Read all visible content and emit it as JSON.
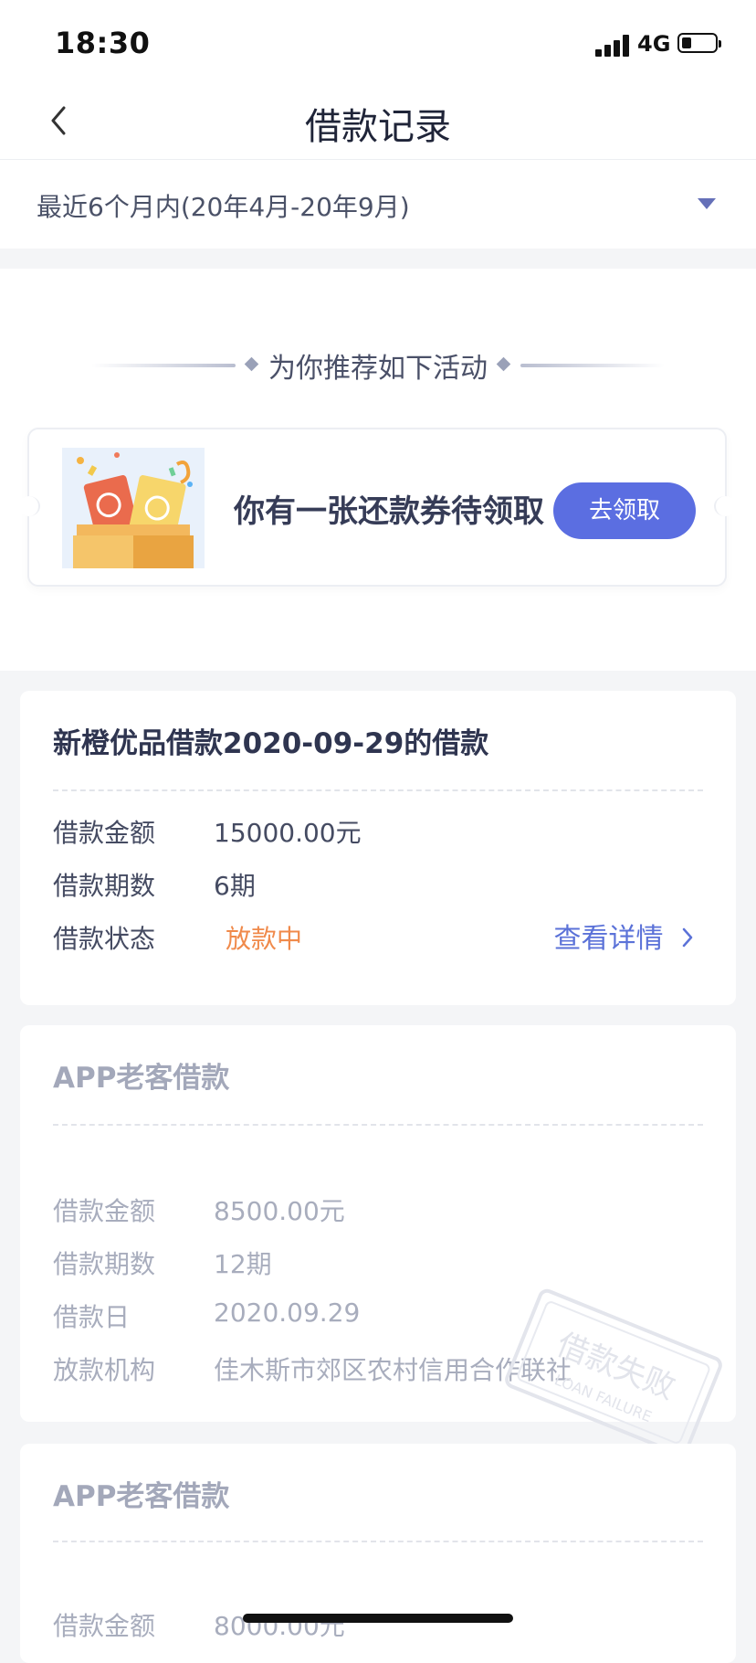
{
  "status_bar": {
    "time": "18:30",
    "network": "4G",
    "battery_level": 0.3
  },
  "nav": {
    "title": "借款记录"
  },
  "filter": {
    "selected_range": "最近6个月内(20年4月-20年9月)"
  },
  "promo": {
    "header": "为你推荐如下活动",
    "coupon_text": "你有一张还款券待领取",
    "claim_button": "去领取"
  },
  "loans": [
    {
      "title": "新橙优品借款2020-09-29的借款",
      "amount_label": "借款金额",
      "amount_value": "15000.00元",
      "periods_label": "借款期数",
      "periods_value": "6期",
      "status_label": "借款状态",
      "status_value": "放款中",
      "detail_link": "查看详情"
    },
    {
      "title": "APP老客借款",
      "amount_label": "借款金额",
      "amount_value": "8500.00元",
      "periods_label": "借款期数",
      "periods_value": "12期",
      "date_label": "借款日",
      "date_value": "2020.09.29",
      "org_label": "放款机构",
      "org_value": "佳木斯市郊区农村信用合作联社",
      "stamp_text": "借款失败",
      "stamp_subtext": "LOAN FAILURE"
    },
    {
      "title": "APP老客借款",
      "amount_label": "借款金额",
      "amount_value": "8000.00元"
    }
  ],
  "colors": {
    "accent": "#5b6ee1",
    "status_pending": "#f08a4b",
    "link": "#5b72d8",
    "background": "#f4f5f7"
  }
}
